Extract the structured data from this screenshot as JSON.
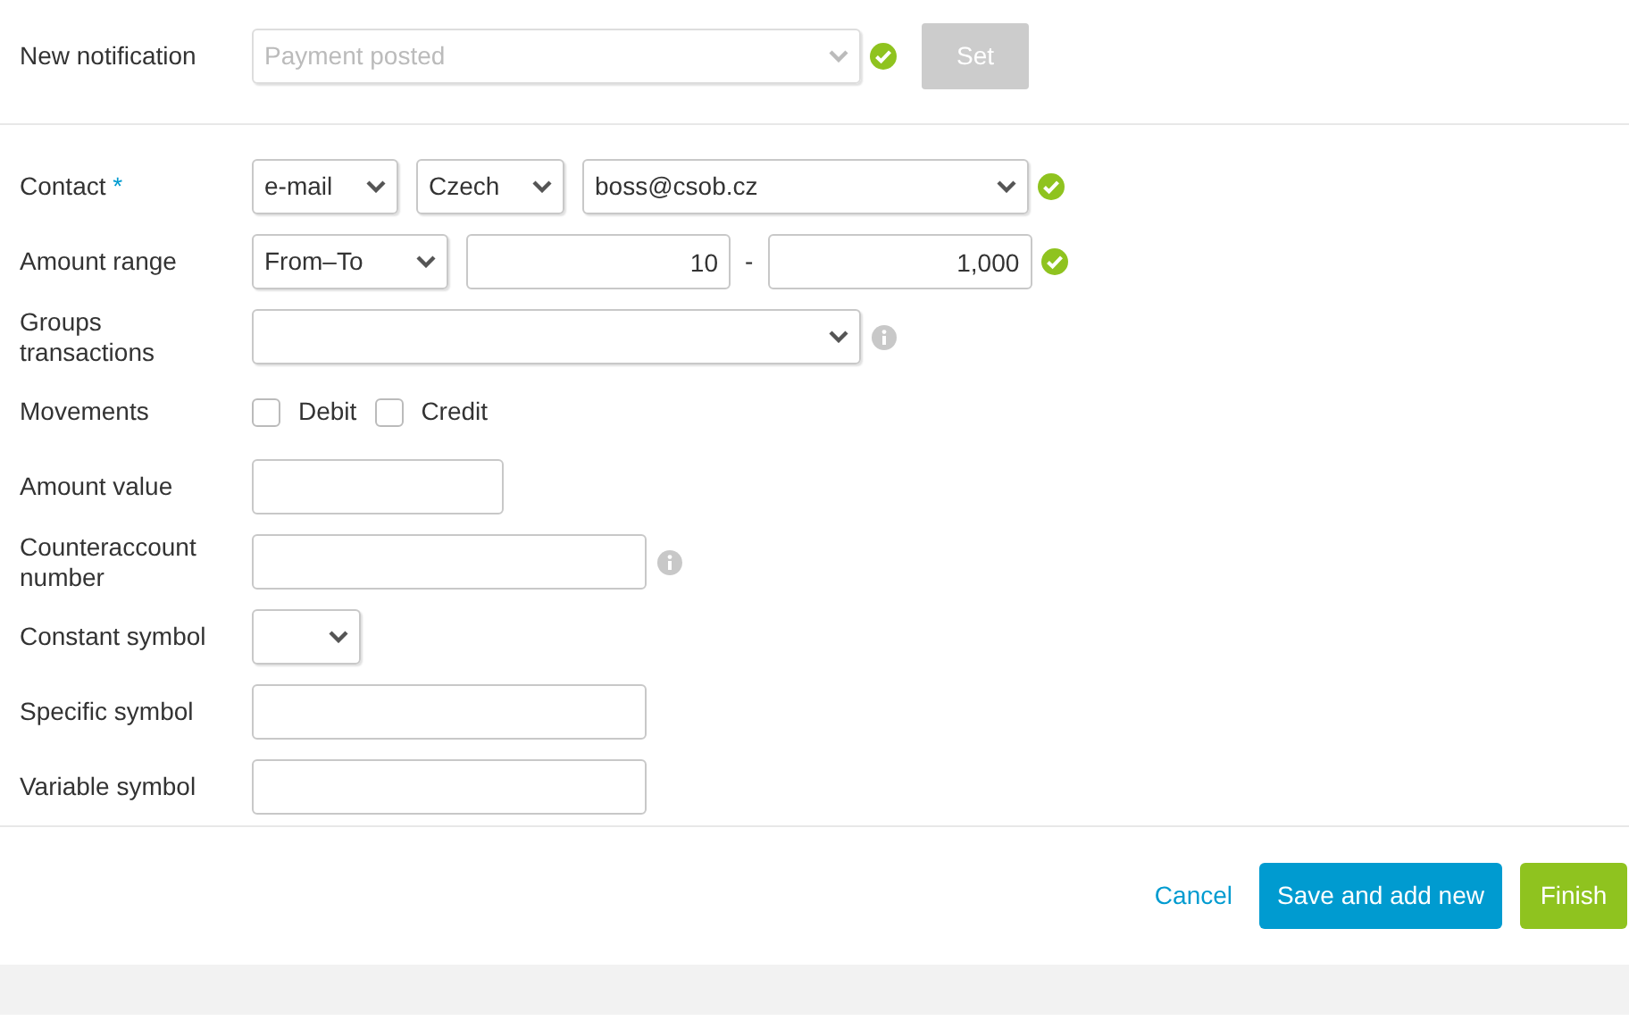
{
  "notification": {
    "label": "New notification",
    "value": "Payment posted",
    "disabled": true,
    "valid": true,
    "button": "Set",
    "button_disabled": true
  },
  "rows": [
    {
      "label": "Contact",
      "required": true,
      "mark": "*",
      "valid": true,
      "controls": [
        {
          "kind": "select",
          "value": "e-mail"
        },
        {
          "kind": "select",
          "value": "Czech"
        },
        {
          "kind": "select",
          "value": "boss@csob.cz"
        }
      ]
    },
    {
      "label": "Amount range",
      "valid": true,
      "controls": [
        {
          "kind": "select",
          "value": "From–To"
        },
        {
          "kind": "input",
          "value": "10"
        },
        {
          "kind": "separator",
          "text": "-"
        },
        {
          "kind": "input",
          "value": "1,000"
        }
      ]
    },
    {
      "label": "Groups transactions",
      "info": true,
      "controls": [
        {
          "kind": "select"
        }
      ]
    },
    {
      "label": "Movements",
      "controls": [
        {
          "kind": "checkbox",
          "text": "Debit",
          "checked": false
        },
        {
          "kind": "checkbox",
          "text": "Credit",
          "checked": false
        }
      ]
    },
    {
      "label": "Amount value",
      "controls": [
        {
          "kind": "input"
        }
      ]
    },
    {
      "label": "Counteraccount number",
      "info": true,
      "controls": [
        {
          "kind": "input"
        }
      ]
    },
    {
      "label": "Constant symbol",
      "controls": [
        {
          "kind": "select"
        }
      ]
    },
    {
      "label": "Specific symbol",
      "controls": [
        {
          "kind": "input"
        }
      ]
    },
    {
      "label": "Variable symbol",
      "controls": [
        {
          "kind": "input"
        }
      ]
    }
  ],
  "footer": {
    "cancel": "Cancel",
    "save": "Save and add new",
    "finish": "Finish"
  }
}
